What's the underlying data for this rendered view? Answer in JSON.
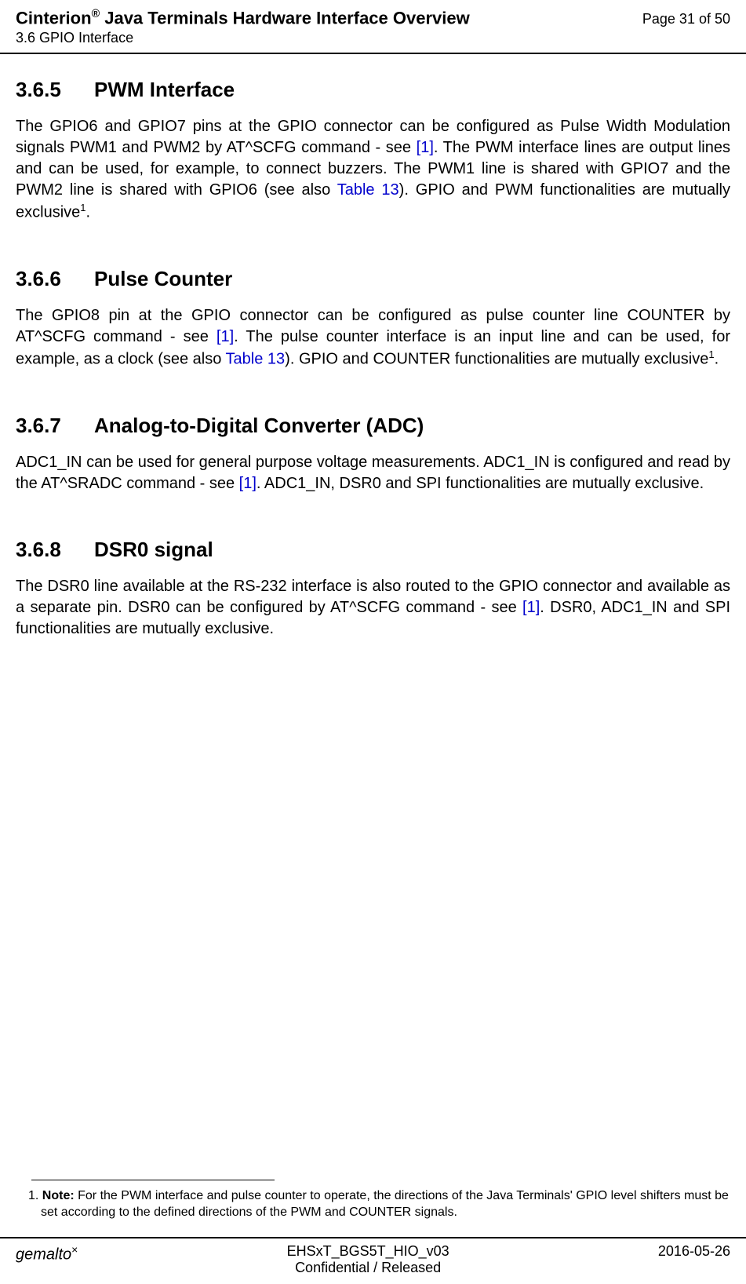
{
  "header": {
    "title_prefix": "Cinterion",
    "title_reg": "®",
    "title_suffix": " Java Terminals Hardware Interface Overview",
    "subsection": "3.6 GPIO Interface",
    "page_number": "Page 31 of 50"
  },
  "sections": {
    "s365": {
      "num": "3.6.5",
      "title": "PWM Interface",
      "p1a": "The GPIO6 and GPIO7 pins at the GPIO connector can be configured as Pulse Width Modulation signals PWM1 and PWM2 by AT^SCFG command - see ",
      "link1": "[1]",
      "p1b": ". The PWM interface lines are output lines and can be used, for example, to connect buzzers. The PWM1 line is shared with GPIO7 and the PWM2 line is shared with GPIO6 (see also ",
      "link2": "Table 13",
      "p1c": "). GPIO and PWM functionalities are mutually exclusive",
      "sup": "1",
      "p1d": "."
    },
    "s366": {
      "num": "3.6.6",
      "title": "Pulse Counter",
      "p1a": "The GPIO8 pin at the GPIO connector can be configured as pulse counter line COUNTER by AT^SCFG command - see ",
      "link1": "[1]",
      "p1b": ". The pulse counter interface is an input line and can be used, for example, as a clock (see also ",
      "link2": "Table 13",
      "p1c": "). GPIO and COUNTER functionalities are mutually exclusive",
      "sup": "1",
      "p1d": "."
    },
    "s367": {
      "num": "3.6.7",
      "title": "Analog-to-Digital Converter (ADC)",
      "p1a": "ADC1_IN can be used for general purpose voltage measurements. ADC1_IN is configured and read by the AT^SRADC command - see ",
      "link1": "[1]",
      "p1b": ". ADC1_IN, DSR0 and SPI functionalities are mutually exclusive."
    },
    "s368": {
      "num": "3.6.8",
      "title": "DSR0 signal",
      "p1a": "The DSR0 line available at the RS-232 interface is also routed to the GPIO connector and available as a separate pin. DSR0 can be configured by AT^SCFG command - see ",
      "link1": "[1]",
      "p1b": ". DSR0, ADC1_IN and SPI functionalities are mutually exclusive."
    }
  },
  "footnote": {
    "num": "1. ",
    "label": "Note:",
    "text": " For the PWM interface and pulse counter to operate, the directions of the Java Terminals' GPIO level shifters must be set according to the defined directions of the PWM and COUNTER signals."
  },
  "footer": {
    "logo": "gemalto",
    "logo_x": "×",
    "doc_id": "EHSxT_BGS5T_HIO_v03",
    "confidentiality": "Confidential / Released",
    "date": "2016-05-26"
  }
}
